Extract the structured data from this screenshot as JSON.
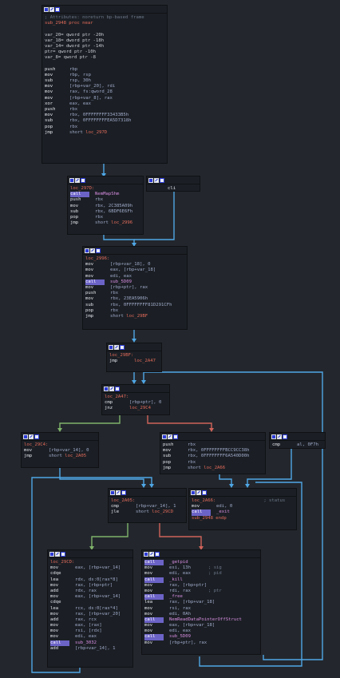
{
  "colors": {
    "edge_uncond": "#4fa7e6",
    "edge_true": "#7fb36a",
    "edge_false": "#d0635a",
    "label": "#e26a5a",
    "call_highlight": "#6c63c7"
  },
  "blocks": {
    "b1": [
      {
        "t": "cmt",
        "text": "; Attributes: noreturn bp-based frame"
      },
      {
        "t": "hdr",
        "text": "sub_2948 proc near"
      },
      {
        "t": "txt",
        "text": ""
      },
      {
        "t": "txt",
        "text": "var_20= qword ptr -20h"
      },
      {
        "t": "txt",
        "text": "var_18= dword ptr -18h"
      },
      {
        "t": "txt",
        "text": "var_14= dword ptr -14h"
      },
      {
        "t": "txt",
        "text": "ptr= qword ptr -10h"
      },
      {
        "t": "txt",
        "text": "var_8= qword ptr -8"
      },
      {
        "t": "txt",
        "text": ""
      },
      {
        "t": "ins",
        "mn": "push",
        "op": "rbp"
      },
      {
        "t": "ins",
        "mn": "mov",
        "op": "rbp, rsp"
      },
      {
        "t": "ins",
        "mn": "sub",
        "op": "rsp, 30h"
      },
      {
        "t": "ins",
        "mn": "mov",
        "op": "[rbp+var_20], rdi"
      },
      {
        "t": "ins",
        "mn": "mov",
        "op": "rax, fs:qword_28"
      },
      {
        "t": "ins",
        "mn": "mov",
        "op": "[rbp+var_8], rax"
      },
      {
        "t": "ins",
        "mn": "xor",
        "op": "eax, eax"
      },
      {
        "t": "ins",
        "mn": "push",
        "op": "rbx"
      },
      {
        "t": "ins",
        "mn": "mov",
        "op": "rbx, 0FFFFFFFF33433B5h"
      },
      {
        "t": "ins",
        "mn": "sub",
        "op": "rbx, 0FFFFFFFFEA5D7318h"
      },
      {
        "t": "ins",
        "mn": "pop",
        "op": "rbx"
      },
      {
        "t": "jmp",
        "mn": "jmp",
        "op": "short ",
        "loc": "loc_297D"
      }
    ],
    "b2": [
      {
        "t": "lbl",
        "text": "loc_297D:"
      },
      {
        "t": "call",
        "mn": "call",
        "op": "NemMapShm"
      },
      {
        "t": "ins",
        "mn": "push",
        "op": "rbx"
      },
      {
        "t": "ins",
        "mn": "mov",
        "op": "rbx, 2C385A09h"
      },
      {
        "t": "ins",
        "mn": "sub",
        "op": "rbx, 6BDF6E6Fh"
      },
      {
        "t": "ins",
        "mn": "pop",
        "op": "rbx"
      },
      {
        "t": "jmp",
        "mn": "jmp",
        "op": "short ",
        "loc": "loc_2996"
      }
    ],
    "b3": [
      {
        "t": "ins",
        "mn": "cli",
        "op": ""
      }
    ],
    "b4": [
      {
        "t": "lbl",
        "text": "loc_2996:"
      },
      {
        "t": "ins",
        "mn": "mov",
        "op": "[rbp+var_18], 0"
      },
      {
        "t": "ins",
        "mn": "mov",
        "op": "eax, [rbp+var_18]"
      },
      {
        "t": "ins",
        "mn": "mov",
        "op": "edi, eax"
      },
      {
        "t": "call",
        "mn": "call",
        "op": "sub_5D09"
      },
      {
        "t": "ins",
        "mn": "mov",
        "op": "[rbp+ptr], rax"
      },
      {
        "t": "ins",
        "mn": "push",
        "op": "rbx"
      },
      {
        "t": "ins",
        "mn": "mov",
        "op": "rbx, 23EA5906h"
      },
      {
        "t": "ins",
        "mn": "sub",
        "op": "rbx, 0FFFFFFFF81D291CFh"
      },
      {
        "t": "ins",
        "mn": "pop",
        "op": "rbx"
      },
      {
        "t": "jmp",
        "mn": "jmp",
        "op": "short ",
        "loc": "loc_29BF"
      }
    ],
    "b5": [
      {
        "t": "lbl",
        "text": "loc_29BF:"
      },
      {
        "t": "jmp",
        "mn": "jmp",
        "op": "",
        "loc": "loc_2A47"
      }
    ],
    "b6": [
      {
        "t": "lbl",
        "text": "loc_2A47:"
      },
      {
        "t": "ins",
        "mn": "cmp",
        "op": "[rbp+ptr], 0"
      },
      {
        "t": "jmp",
        "mn": "jnz",
        "op": "",
        "loc": "loc_29C4"
      }
    ],
    "b7": [
      {
        "t": "lbl",
        "text": "loc_29C4:"
      },
      {
        "t": "ins",
        "mn": "mov",
        "op": "[rbp+var_14], 0"
      },
      {
        "t": "jmp",
        "mn": "jmp",
        "op": "short ",
        "loc": "loc_2A05"
      }
    ],
    "b8": [
      {
        "t": "ins",
        "mn": "push",
        "op": "rbx"
      },
      {
        "t": "ins",
        "mn": "mov",
        "op": "rbx, 0FFFFFFFFBCC9CC38h"
      },
      {
        "t": "ins",
        "mn": "sub",
        "op": "rbx, 0FFFFFFFF6A540D00h"
      },
      {
        "t": "ins",
        "mn": "pop",
        "op": "rbx"
      },
      {
        "t": "jmp",
        "mn": "jmp",
        "op": "short ",
        "loc": "loc_2A66"
      }
    ],
    "b9": [
      {
        "t": "ins",
        "mn": "cmp",
        "op": "al, 0F7h"
      }
    ],
    "b10": [
      {
        "t": "lbl",
        "text": "loc_2A05:"
      },
      {
        "t": "ins",
        "mn": "cmp",
        "op": "[rbp+var_14], 1"
      },
      {
        "t": "jmp",
        "mn": "jle",
        "op": "short ",
        "loc": "loc_29CD"
      }
    ],
    "b11": [
      {
        "t": "lblc",
        "text": "loc_2A66:",
        "cmt": "; status"
      },
      {
        "t": "ins",
        "mn": "mov",
        "op": "edi, 0"
      },
      {
        "t": "call",
        "mn": "call",
        "op": "_exit"
      },
      {
        "t": "hdr",
        "text": "sub_2948 endp"
      }
    ],
    "b12": [
      {
        "t": "lbl",
        "text": "loc_29CD:"
      },
      {
        "t": "ins",
        "mn": "mov",
        "op": "eax, [rbp+var_14]"
      },
      {
        "t": "ins",
        "mn": "cdqe",
        "op": ""
      },
      {
        "t": "ins",
        "mn": "lea",
        "op": "rdx, ds:0[rax*8]"
      },
      {
        "t": "ins",
        "mn": "mov",
        "op": "rax, [rbp+ptr]"
      },
      {
        "t": "ins",
        "mn": "add",
        "op": "rdx, rax"
      },
      {
        "t": "ins",
        "mn": "mov",
        "op": "eax, [rbp+var_14]"
      },
      {
        "t": "ins",
        "mn": "cdqe",
        "op": ""
      },
      {
        "t": "ins",
        "mn": "lea",
        "op": "rcx, ds:0[rax*4]"
      },
      {
        "t": "ins",
        "mn": "mov",
        "op": "rax, [rbp+var_20]"
      },
      {
        "t": "ins",
        "mn": "add",
        "op": "rax, rcx"
      },
      {
        "t": "ins",
        "mn": "mov",
        "op": "eax, [rax]"
      },
      {
        "t": "ins",
        "mn": "mov",
        "op": "rsi, [rdx]"
      },
      {
        "t": "ins",
        "mn": "mov",
        "op": "edi, eax"
      },
      {
        "t": "call",
        "mn": "call",
        "op": "sub_3032"
      },
      {
        "t": "ins",
        "mn": "add",
        "op": "[rbp+var_14], 1"
      }
    ],
    "b13": [
      {
        "t": "call",
        "mn": "call",
        "op": "_getpid"
      },
      {
        "t": "insc",
        "mn": "mov",
        "op": "esi, 13h",
        "cmt": "; sig"
      },
      {
        "t": "insc",
        "mn": "mov",
        "op": "edi, eax",
        "cmt": "; pid"
      },
      {
        "t": "call",
        "mn": "call",
        "op": "_kill"
      },
      {
        "t": "ins",
        "mn": "mov",
        "op": "rax, [rbp+ptr]"
      },
      {
        "t": "insc",
        "mn": "mov",
        "op": "rdi, rax",
        "cmt": "; ptr"
      },
      {
        "t": "call",
        "mn": "call",
        "op": "_free"
      },
      {
        "t": "ins",
        "mn": "lea",
        "op": "rax, [rbp+var_18]"
      },
      {
        "t": "ins",
        "mn": "mov",
        "op": "rsi, rax"
      },
      {
        "t": "ins",
        "mn": "mov",
        "op": "edi, 0Ah"
      },
      {
        "t": "call",
        "mn": "call",
        "op": "NemReadDataPointerOffStruct"
      },
      {
        "t": "ins",
        "mn": "mov",
        "op": "eax, [rbp+var_18]"
      },
      {
        "t": "ins",
        "mn": "mov",
        "op": "edi, eax"
      },
      {
        "t": "call",
        "mn": "call",
        "op": "sub_5D09"
      },
      {
        "t": "ins",
        "mn": "mov",
        "op": "[rbp+ptr], rax"
      }
    ]
  }
}
